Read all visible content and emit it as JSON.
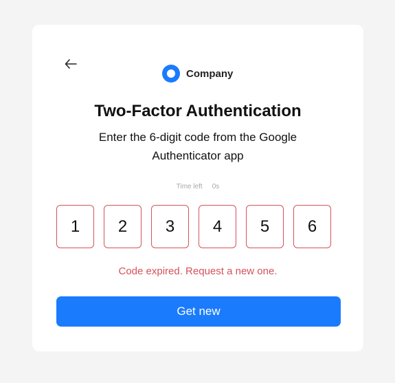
{
  "brand": {
    "name": "Company",
    "logo_icon": "company-logo-icon",
    "accent": "#1b7bfd"
  },
  "nav": {
    "back_icon": "arrow-left-icon"
  },
  "heading": {
    "title": "Two-Factor Authentication",
    "subtitle": "Enter the 6-digit code from the Google Authenticator app"
  },
  "timer": {
    "label": "Time left",
    "value": "0s"
  },
  "code": {
    "digits": [
      "1",
      "2",
      "3",
      "4",
      "5",
      "6"
    ],
    "error_color": "#d4525a"
  },
  "error": {
    "message": "Code expired. Request a new one."
  },
  "action": {
    "button_label": "Get new"
  }
}
